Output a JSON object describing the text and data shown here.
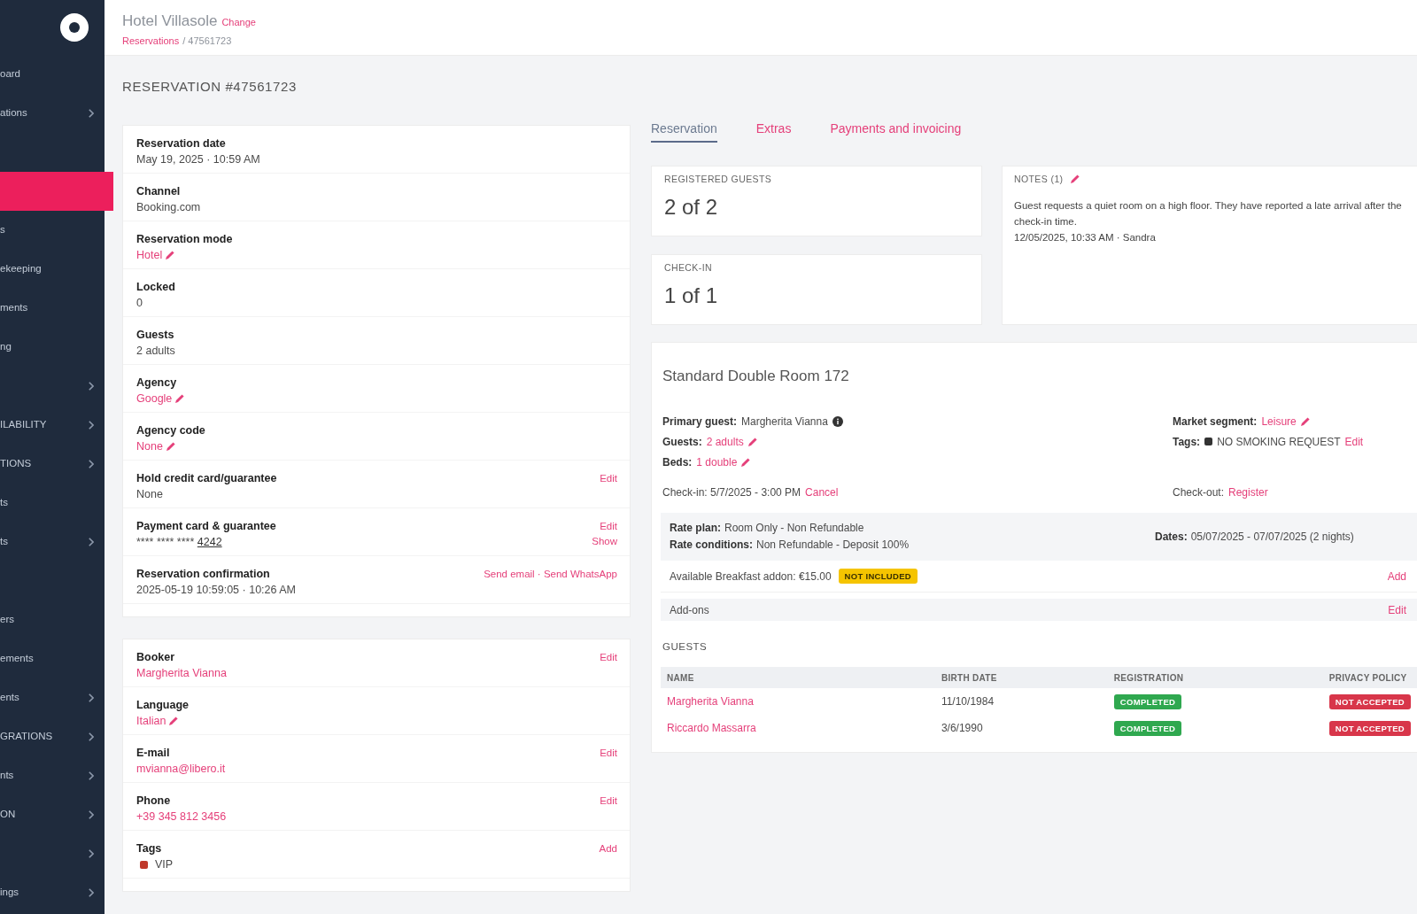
{
  "sidebar": {
    "sections": [
      {
        "items": [
          {
            "label": "oard",
            "selected": false,
            "submenu": false
          },
          {
            "label": "ations",
            "selected": false,
            "submenu": true
          }
        ]
      },
      {
        "items": [
          {
            "selected": true,
            "submenu": false
          },
          {
            "label": "s",
            "selected": false,
            "submenu": false
          },
          {
            "label": "ekeeping",
            "selected": false,
            "submenu": false
          },
          {
            "label": "ments",
            "selected": false,
            "submenu": false
          },
          {
            "label": "ng",
            "selected": false,
            "submenu": false
          },
          {
            "selected": false,
            "submenu": true
          },
          {
            "label": "ILABILITY",
            "selected": false,
            "submenu": true
          },
          {
            "label": "TIONS",
            "selected": false,
            "submenu": true
          },
          {
            "label": "ts",
            "selected": false,
            "submenu": false
          },
          {
            "label": "ts",
            "selected": false,
            "submenu": true
          }
        ]
      },
      {
        "items": [
          {
            "label": "ers",
            "selected": false,
            "submenu": false
          },
          {
            "label": "ements",
            "selected": false,
            "submenu": false
          },
          {
            "label": "ents",
            "selected": false,
            "submenu": true
          },
          {
            "label": "GRATIONS",
            "selected": false,
            "submenu": true
          },
          {
            "label": "nts",
            "selected": false,
            "submenu": true
          },
          {
            "label": "ON",
            "selected": false,
            "submenu": true
          },
          {
            "selected": false,
            "submenu": true
          },
          {
            "label": "ings",
            "selected": false,
            "submenu": true
          }
        ]
      }
    ]
  },
  "header": {
    "title": "Hotel Villasole",
    "change_link": "Change",
    "breadcrumb": {
      "link": "Reservations",
      "current": "/ 47561723"
    }
  },
  "page_title": "RESERVATION #47561723",
  "details": [
    {
      "fields": [
        {
          "label": "Reservation date",
          "kind": "text",
          "value": "May 19, 2025 · 10:59 AM"
        },
        {
          "label": "Channel",
          "kind": "text",
          "value": "Booking.com"
        },
        {
          "label": "Reservation mode",
          "kind": "editable",
          "value": "Hotel"
        },
        {
          "label": "Locked",
          "kind": "text",
          "value": "0"
        },
        {
          "label": "Guests",
          "kind": "text",
          "value": "2 adults"
        },
        {
          "label": "Agency",
          "kind": "editable",
          "value": "Google"
        },
        {
          "label": "Agency code",
          "kind": "editable",
          "value": "None"
        },
        {
          "label": "Hold credit card/guarantee",
          "kind": "text",
          "value": "None",
          "actions": [
            "Edit"
          ]
        },
        {
          "label": "Payment card & guarantee",
          "kind": "card",
          "value": "**** **** ****",
          "suffix": "4242",
          "actions": [
            "Edit",
            "Show"
          ]
        },
        {
          "label": "Reservation confirmation",
          "kind": "text",
          "value": "2025-05-19 10:59:05 · 10:26 AM",
          "actions": [
            "Send email · Send WhatsApp"
          ]
        }
      ]
    },
    {
      "fields": [
        {
          "label": "Booker",
          "kind": "link",
          "value": "Margherita Vianna",
          "actions": [
            "Edit"
          ]
        },
        {
          "label": "Language",
          "kind": "editable",
          "value": "Italian"
        },
        {
          "label": "E-mail",
          "kind": "link",
          "value": "mvianna@libero.it",
          "actions": [
            "Edit"
          ]
        },
        {
          "label": "Phone",
          "kind": "link",
          "value": "+39 345 812 3456",
          "actions": [
            "Edit"
          ]
        },
        {
          "label": "Tags",
          "kind": "tag",
          "value": "VIP",
          "color": "#c0392b",
          "actions": [
            "Add"
          ]
        }
      ]
    }
  ],
  "tabs": [
    {
      "label": "Reservation",
      "selected": true
    },
    {
      "label": "Extras",
      "selected": false
    },
    {
      "label": "Payments and invoicing",
      "selected": false
    }
  ],
  "summary": [
    {
      "label": "REGISTERED GUESTS",
      "value": "2 of 2"
    },
    {
      "label": "CHECK-IN",
      "value": "1 of 1"
    }
  ],
  "notes": {
    "title": "NOTES (1)",
    "text": "Guest requests a quiet room on a high floor. They have reported a late arrival after the check-in time.",
    "meta": "12/05/2025, 10:33 AM · Sandra"
  },
  "room": {
    "title": "Standard Double Room 172",
    "details_left": [
      {
        "label": "Primary guest:",
        "kind": "guest",
        "value": "Margherita Vianna"
      },
      {
        "label": "Guests:",
        "kind": "editable",
        "value": "2 adults"
      },
      {
        "label": "Beds:",
        "kind": "editable",
        "value": "1 double"
      }
    ],
    "details_right": [
      {
        "label": "Market segment:",
        "kind": "editable",
        "value": "Leisure"
      },
      {
        "label": "Tags:",
        "kind": "tag",
        "value": "NO SMOKING REQUEST",
        "color": "#333333",
        "action": "Edit"
      }
    ],
    "checkin": {
      "text": "Check-in: 5/7/2025 - 3:00 PM",
      "action": "Cancel"
    },
    "checkout": {
      "text": "Check-out:",
      "action": "Register"
    },
    "rate": [
      {
        "label": "Rate plan:",
        "value": "Room Only - Non Refundable"
      },
      {
        "label": "Rate conditions:",
        "value": "Non Refundable - Deposit 100%"
      }
    ],
    "dates": {
      "label": "Dates:",
      "value": "05/07/2025 - 07/07/2025 (2 nights)"
    },
    "extras": [
      {
        "text": "Available Breakfast addon: €15.00",
        "badge": {
          "text": "NOT INCLUDED",
          "kind": "warning"
        },
        "action": "Add"
      },
      {
        "text": "Add-ons",
        "action": "Edit"
      }
    ]
  },
  "guests": {
    "title": "GUESTS",
    "columns": [
      "NAME",
      "BIRTH DATE",
      "REGISTRATION",
      "PRIVACY POLICY"
    ],
    "rows": [
      {
        "name": "Margherita Vianna",
        "birth_date": "11/10/1984",
        "registration": {
          "text": "COMPLETED",
          "kind": "success"
        },
        "privacy": {
          "text": "NOT ACCEPTED",
          "kind": "danger"
        }
      },
      {
        "name": "Riccardo Massarra",
        "birth_date": "3/6/1990",
        "registration": {
          "text": "COMPLETED",
          "kind": "success"
        },
        "privacy": {
          "text": "NOT ACCEPTED",
          "kind": "danger"
        }
      }
    ]
  }
}
